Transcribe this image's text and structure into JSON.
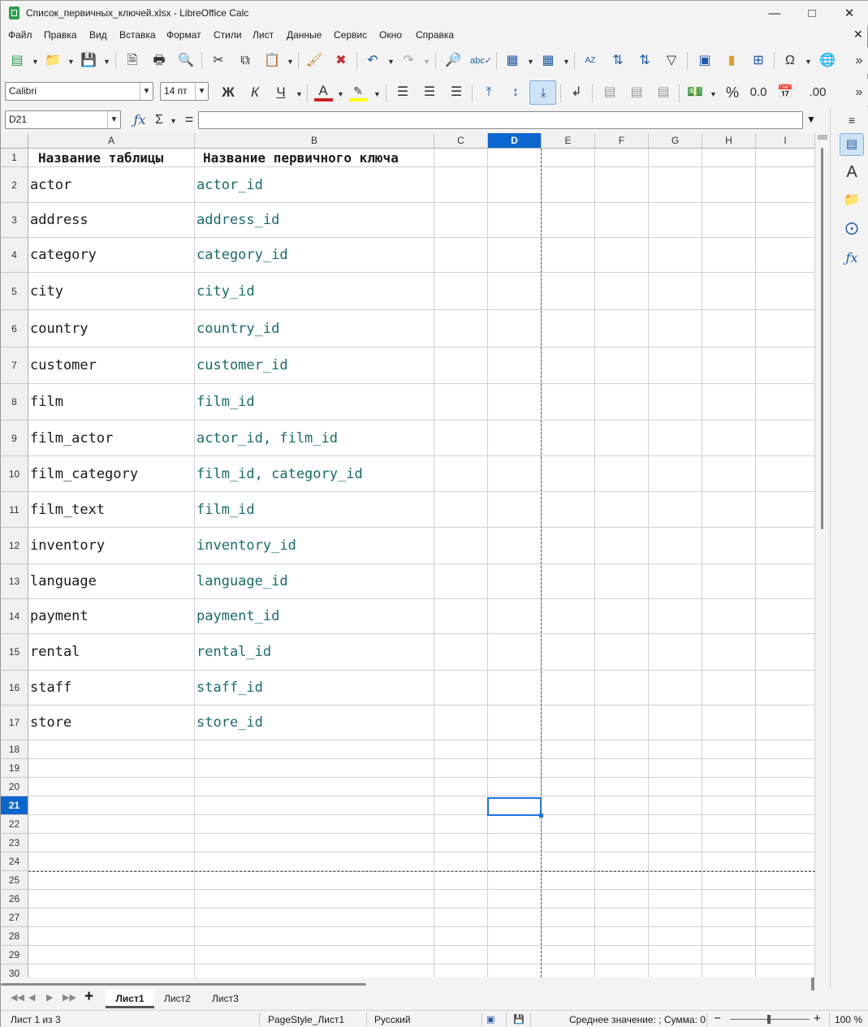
{
  "window": {
    "title": "Список_первичных_ключей.xlsx - LibreOffice Calc"
  },
  "menu": [
    "Файл",
    "Правка",
    "Вид",
    "Вставка",
    "Формат",
    "Стили",
    "Лист",
    "Данные",
    "Сервис",
    "Окно",
    "Справка"
  ],
  "format_bar": {
    "font_name": "Calibri",
    "font_size": "14 пт",
    "bold": "Ж",
    "italic": "К",
    "underline": "Ч"
  },
  "formula_bar": {
    "name_box": "D21",
    "formula": ""
  },
  "columns": [
    "A",
    "B",
    "C",
    "D",
    "E",
    "F",
    "G",
    "H",
    "I"
  ],
  "selected_cell": "D21",
  "rows": [
    {
      "n": "1",
      "a": "Название таблицы",
      "b": "Название первичного ключа"
    },
    {
      "n": "2",
      "a": "actor",
      "b": "actor_id"
    },
    {
      "n": "3",
      "a": "address",
      "b": "address_id"
    },
    {
      "n": "4",
      "a": "category",
      "b": "category_id"
    },
    {
      "n": "5",
      "a": "city",
      "b": "city_id"
    },
    {
      "n": "6",
      "a": "country",
      "b": "country_id"
    },
    {
      "n": "7",
      "a": "customer",
      "b": "customer_id"
    },
    {
      "n": "8",
      "a": "film",
      "b": "film_id"
    },
    {
      "n": "9",
      "a": "film_actor",
      "b": "actor_id, film_id"
    },
    {
      "n": "10",
      "a": "film_category",
      "b": "film_id, category_id"
    },
    {
      "n": "11",
      "a": "film_text",
      "b": "film_id"
    },
    {
      "n": "12",
      "a": "inventory",
      "b": "inventory_id"
    },
    {
      "n": "13",
      "a": "language",
      "b": "language_id"
    },
    {
      "n": "14",
      "a": "payment",
      "b": "payment_id"
    },
    {
      "n": "15",
      "a": "rental",
      "b": "rental_id"
    },
    {
      "n": "16",
      "a": "staff",
      "b": "staff_id"
    },
    {
      "n": "17",
      "a": "store",
      "b": "store_id"
    },
    {
      "n": "18",
      "a": "",
      "b": ""
    },
    {
      "n": "19",
      "a": "",
      "b": ""
    },
    {
      "n": "20",
      "a": "",
      "b": ""
    },
    {
      "n": "21",
      "a": "",
      "b": ""
    },
    {
      "n": "22",
      "a": "",
      "b": ""
    },
    {
      "n": "23",
      "a": "",
      "b": ""
    },
    {
      "n": "24",
      "a": "",
      "b": ""
    },
    {
      "n": "25",
      "a": "",
      "b": ""
    },
    {
      "n": "26",
      "a": "",
      "b": ""
    },
    {
      "n": "27",
      "a": "",
      "b": ""
    },
    {
      "n": "28",
      "a": "",
      "b": ""
    },
    {
      "n": "29",
      "a": "",
      "b": ""
    },
    {
      "n": "30",
      "a": "",
      "b": ""
    }
  ],
  "sheet_tabs": [
    "Лист1",
    "Лист2",
    "Лист3"
  ],
  "active_sheet": "Лист1",
  "status": {
    "sheet": "Лист 1 из 3",
    "page_style": "PageStyle_Лист1",
    "language": "Русский",
    "summary": "Среднее значение: ; Сумма: 0",
    "zoom": "100 %"
  },
  "colors": {
    "accent": "#0b66d0",
    "key_text": "#1a6b6b",
    "text": "#1a1a1a"
  }
}
